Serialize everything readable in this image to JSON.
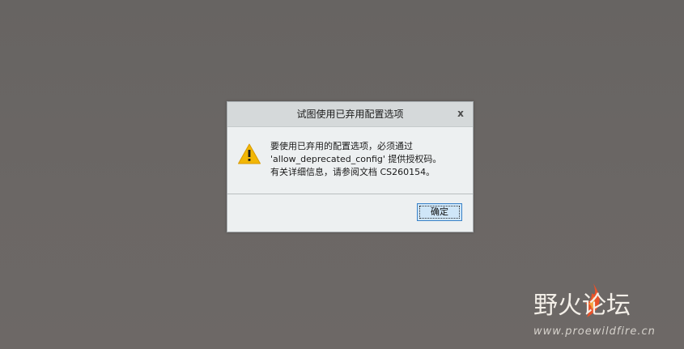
{
  "dialog": {
    "title": "试图使用已弃用配置选项",
    "close_label": "x",
    "icon": "warning-icon",
    "message_lines": [
      "要使用已弃用的配置选项，必须通过",
      "'allow_deprecated_config' 提供授权码。",
      "有关详细信息，请参阅文档 CS260154。"
    ],
    "ok_label": "确定"
  },
  "watermark": {
    "brand": "野火论坛",
    "url": "www.proewildfire.cn"
  },
  "colors": {
    "background": "#6a6664",
    "dialog_bg": "#edf0f1",
    "titlebar_bg": "#d5d9da",
    "button_border": "#3a82c7",
    "button_bg": "#cfe6f8",
    "warning_yellow": "#f2b705",
    "brand_accent": "#e8522a"
  }
}
